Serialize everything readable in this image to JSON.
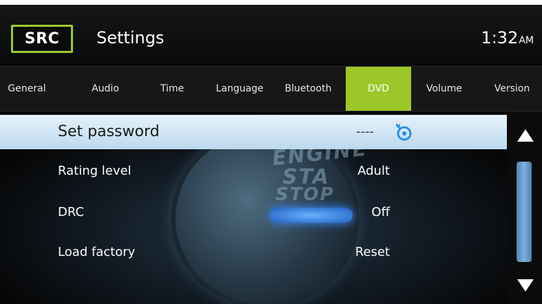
{
  "header": {
    "src_label": "SRC",
    "title": "Settings",
    "clock_time": "1:32",
    "clock_ampm": "AM"
  },
  "tabs": [
    {
      "label": "General",
      "active": false
    },
    {
      "label": "Audio",
      "active": false
    },
    {
      "label": "Time",
      "active": false
    },
    {
      "label": "Language",
      "active": false
    },
    {
      "label": "Bluetooth",
      "active": false
    },
    {
      "label": "DVD",
      "active": true
    },
    {
      "label": "Volume",
      "active": false
    },
    {
      "label": "Version",
      "active": false
    }
  ],
  "background_text": {
    "line1": "ENGINE",
    "line2": "STA",
    "line3": "STOP"
  },
  "rows": [
    {
      "label": "Set password",
      "value": "----",
      "icon": "key-icon",
      "selected": true
    },
    {
      "label": "Rating level",
      "value": "Adult",
      "selected": false
    },
    {
      "label": "DRC",
      "value": "Off",
      "selected": false
    },
    {
      "label": "Load factory",
      "value": "Reset",
      "selected": false
    }
  ],
  "scrollbar": {
    "up_icon": "arrow-up-icon",
    "down_icon": "arrow-down-icon"
  },
  "colors": {
    "accent": "#9cc72a",
    "selection": "#d6eaf6",
    "scroll_thumb": "#6a9ccc"
  }
}
